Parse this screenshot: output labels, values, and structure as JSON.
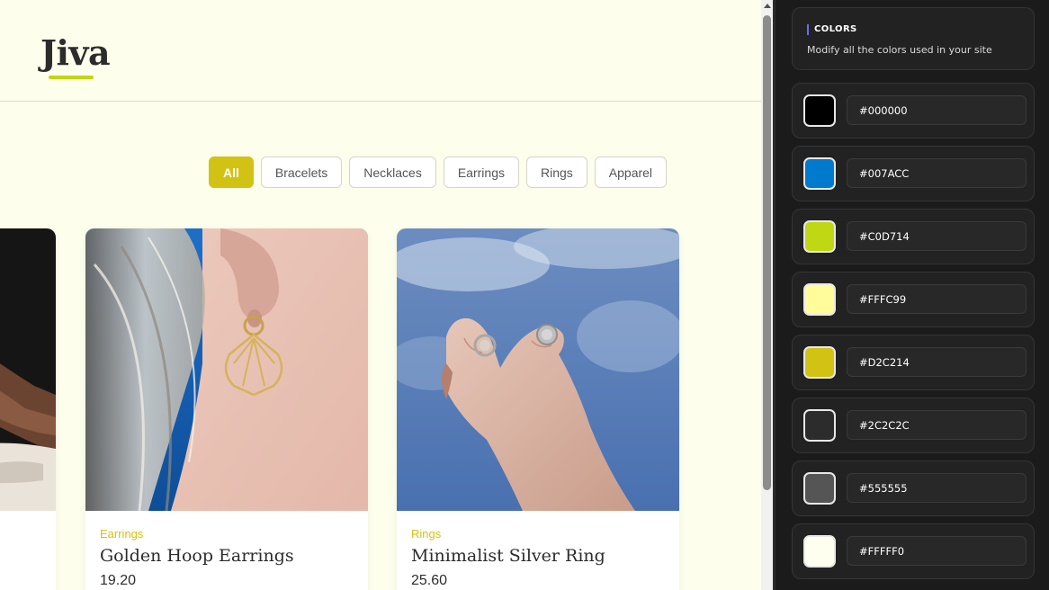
{
  "site": {
    "logo": "Jiva",
    "filters": [
      "All",
      "Bracelets",
      "Necklaces",
      "Earrings",
      "Rings",
      "Apparel"
    ],
    "active_filter": "All",
    "products": [
      {
        "category": "Earrings",
        "title": "Golden Hoop Earrings",
        "price": "19.20"
      },
      {
        "category": "Rings",
        "title": "Minimalist Silver Ring",
        "price": "25.60"
      }
    ]
  },
  "panel": {
    "section_title": "COLORS",
    "section_desc": "Modify all the colors used in your site",
    "colors": [
      {
        "hex": "#000000"
      },
      {
        "hex": "#007ACC"
      },
      {
        "hex": "#C0D714"
      },
      {
        "hex": "#FFFC99"
      },
      {
        "hex": "#D2C214"
      },
      {
        "hex": "#2C2C2C"
      },
      {
        "hex": "#555555"
      },
      {
        "hex": "#FFFFF0"
      }
    ]
  }
}
